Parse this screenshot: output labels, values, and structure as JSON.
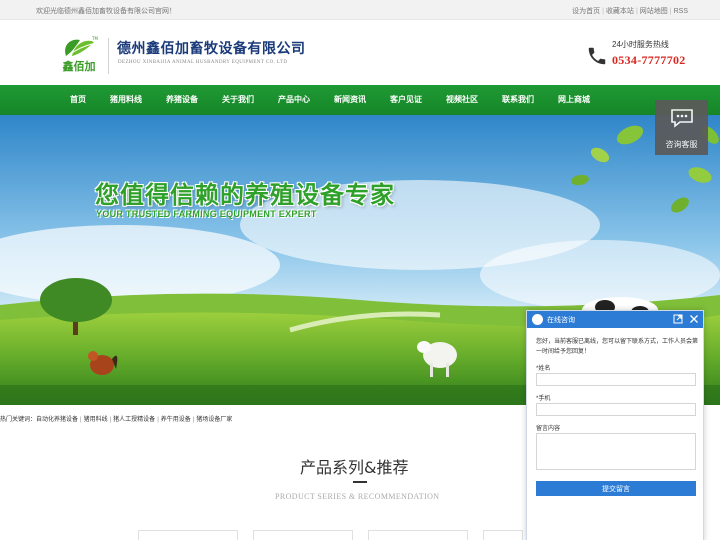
{
  "topbar": {
    "welcome": "欢迎光临德州鑫佰加畜牧设备有限公司官网！",
    "links": [
      "设为首页",
      "收藏本站",
      "网站地图",
      "RSS"
    ]
  },
  "header": {
    "logo_text": "鑫佰加",
    "company_name": "德州鑫佰加畜牧设备有限公司",
    "company_en": "DEZHOU XINBAIJIA ANIMAL HUSBANDRY EQUIPMENT CO. LTD",
    "hotline_label": "24小时服务热线",
    "hotline_number": "0534-7777702"
  },
  "nav": {
    "items": [
      "首页",
      "猪用料线",
      "养猪设备",
      "关于我们",
      "产品中心",
      "新闻资讯",
      "客户见证",
      "视频社区",
      "联系我们",
      "网上商城"
    ]
  },
  "banner": {
    "slogan_cn": "您值得信赖的养殖设备专家",
    "slogan_en": "YOUR TRUSTED FARMING EQUIPMENT EXPERT"
  },
  "consult": {
    "label": "咨询客服"
  },
  "hotwords": {
    "label": "热门关键词：",
    "items": [
      "自动化养猪设备",
      "猪用料线",
      "猪人工授精设备",
      "养牛用设备",
      "猪场设备厂家"
    ]
  },
  "section": {
    "title": "产品系列&推荐",
    "subtitle": "PRODUCT SERIES & RECOMMENDATION"
  },
  "chat": {
    "title": "在线咨询",
    "message": "您好，当前客服已离线，您可以留下联系方式，工作人员会第一时间给予您回复！",
    "name_label": "*姓名",
    "phone_label": "*手机",
    "content_label": "留言内容",
    "submit_label": "提交留言"
  },
  "colors": {
    "nav_green": "#1f9a34",
    "hotline_red": "#d9251d",
    "company_blue": "#1a3a7a",
    "chat_blue": "#2c7cd6"
  }
}
